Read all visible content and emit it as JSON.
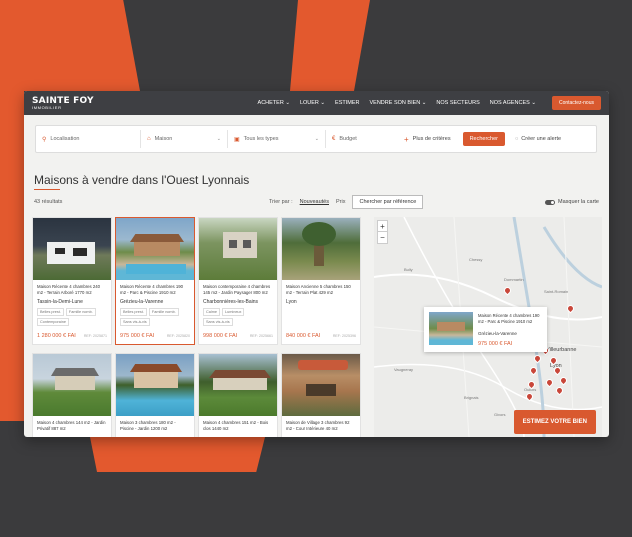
{
  "header": {
    "logo_main": "SAINTE FOY",
    "logo_sub": "IMMOBILIER",
    "nav": [
      {
        "label": "ACHETER",
        "dropdown": true
      },
      {
        "label": "LOUER",
        "dropdown": true
      },
      {
        "label": "ESTIMER",
        "dropdown": false
      },
      {
        "label": "VENDRE SON BIEN",
        "dropdown": true
      },
      {
        "label": "NOS SECTEURS",
        "dropdown": false
      },
      {
        "label": "NOS AGENCES",
        "dropdown": true
      }
    ],
    "contact_label": "Contactez-nous"
  },
  "search": {
    "location_placeholder": "Localisation",
    "property_type": "Maison",
    "subtype": "Tous les types",
    "budget_placeholder": "Budget",
    "more_criteria": "Plus de critères",
    "search_button": "Rechercher",
    "alert_label": "Créer une alerte"
  },
  "listing": {
    "title": "Maisons à vendre dans l'Ouest Lyonnais",
    "count": "43 résultats",
    "sort_label": "Trier par :",
    "sort_options": [
      "Nouveautés",
      "Prix"
    ],
    "ref_search": "Chercher par référence",
    "map_toggle": "Masquer la carte"
  },
  "cards": [
    {
      "title": "Maison Récente 4 chambres 240 m2 - Terrain Arboré 1770 m2",
      "location": "Tassin-la-Demi-Lune",
      "tags": [
        "Belles prest.",
        "Famille nomb.",
        "Contemporaine"
      ],
      "price": "1 280 000 € FAI",
      "ref": "REF: 2025871"
    },
    {
      "title": "Maison Récente 4 chambres 190 m2 - Parc & Piscine 1910 m2",
      "location": "Grézieu-la-Varenne",
      "tags": [
        "Belles prest.",
        "Famille nomb.",
        "Sans vis-à-vis"
      ],
      "price": "975 000 € FAI",
      "ref": "REF: 2025820",
      "selected": true
    },
    {
      "title": "Maison contemporaine 4 chambres 145 m2 - Jardin Paysager 800 m2",
      "location": "Charbonnières-les-Bains",
      "tags": [
        "Calme",
        "Lumineux",
        "Sans vis-à-vis"
      ],
      "price": "998 000 € FAI",
      "ref": "REF: 2025661"
    },
    {
      "title": "Maison Ancienne 5 chambres 150 m2 - Terrain Plat 429 m2",
      "location": "Lyon",
      "tags": [],
      "price": "840 000 € FAI",
      "ref": "REF: 2025396"
    },
    {
      "title": "Maison 4 chambres 144 m2 - Jardin Privatif 887 m2",
      "location": "",
      "tags": [],
      "price": "",
      "ref": ""
    },
    {
      "title": "Maison 3 chambres 180 m2 - Piscine - Jardin 1200 m2",
      "location": "",
      "tags": [],
      "price": "",
      "ref": ""
    },
    {
      "title": "Maison 4 chambres 151 m2 - Bois clos 1440 m2",
      "location": "",
      "tags": [],
      "price": "",
      "ref": ""
    },
    {
      "title": "Maison de Village 3 chambres 92 m2 - Cour Intérieure 40 m2",
      "location": "",
      "tags": [],
      "price": "",
      "ref": ""
    }
  ],
  "map": {
    "zoom_in": "+",
    "zoom_out": "−",
    "popup": {
      "title": "Maison Récente 4 chambres 190 m2 - Parc & Piscine 1910 m2",
      "location": "Grézieu-la-Varenne",
      "price": "975 000 € FAI"
    },
    "labels": [
      "Bully",
      "Chessy",
      "Dommartin",
      "Villeurbanne",
      "Lyon",
      "Saint-Romain",
      "Givors",
      "Brignais",
      "Vaugneray",
      "Oullins",
      "Caluire"
    ],
    "estimate_button": "ESTIMEZ VOTRE BIEN"
  },
  "colors": {
    "accent": "#d9592f",
    "topbar": "#3e3f43",
    "background": "#3b3b3d"
  }
}
